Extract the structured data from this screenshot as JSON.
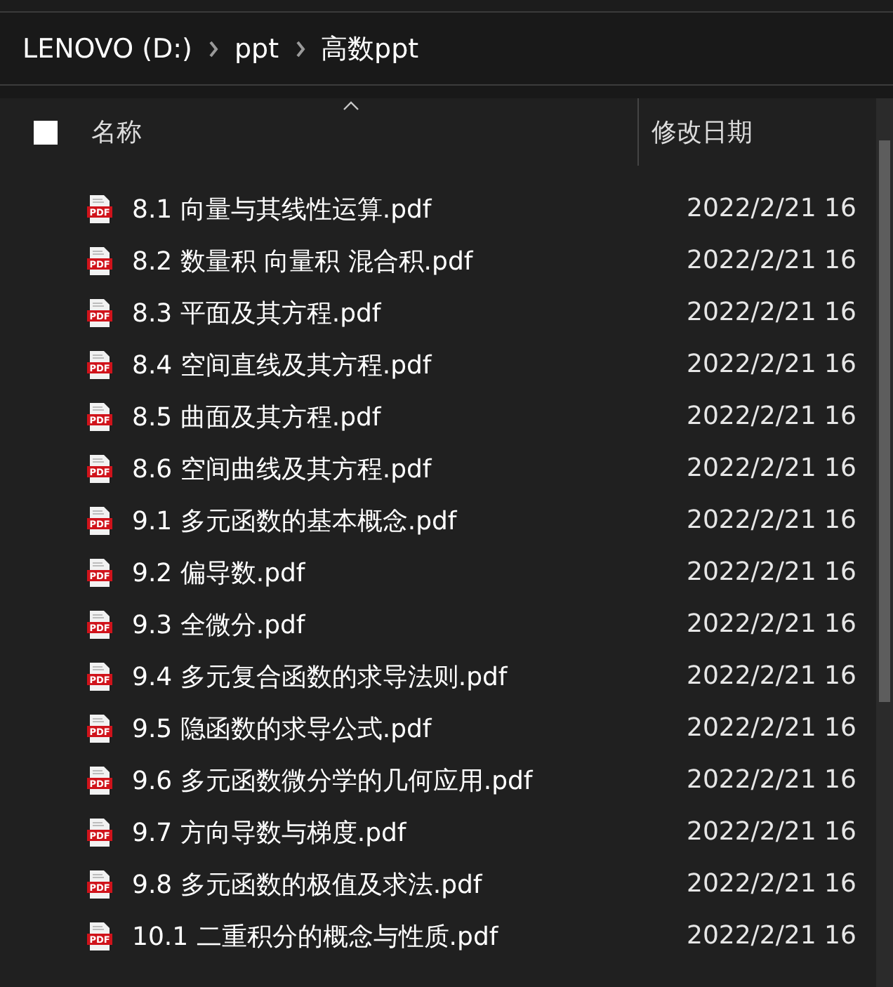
{
  "breadcrumb": [
    {
      "label": "LENOVO (D:)"
    },
    {
      "label": "ppt"
    },
    {
      "label": "高数ppt"
    }
  ],
  "header": {
    "select_all": {
      "checked": false
    },
    "columns": [
      {
        "label": "名称",
        "sorted": true
      },
      {
        "label": "修改日期",
        "sorted": false
      }
    ]
  },
  "files": [
    {
      "badge": "PDF",
      "name": "8.1 向量与其线性运算.pdf",
      "modified": "2022/2/21 16"
    },
    {
      "badge": "PDF",
      "name": "8.2 数量积 向量积 混合积.pdf",
      "modified": "2022/2/21 16"
    },
    {
      "badge": "PDF",
      "name": "8.3 平面及其方程.pdf",
      "modified": "2022/2/21 16"
    },
    {
      "badge": "PDF",
      "name": "8.4 空间直线及其方程.pdf",
      "modified": "2022/2/21 16"
    },
    {
      "badge": "PDF",
      "name": "8.5 曲面及其方程.pdf",
      "modified": "2022/2/21 16"
    },
    {
      "badge": "PDF",
      "name": "8.6 空间曲线及其方程.pdf",
      "modified": "2022/2/21 16"
    },
    {
      "badge": "PDF",
      "name": "9.1 多元函数的基本概念.pdf",
      "modified": "2022/2/21 16"
    },
    {
      "badge": "PDF",
      "name": "9.2 偏导数.pdf",
      "modified": "2022/2/21 16"
    },
    {
      "badge": "PDF",
      "name": "9.3 全微分.pdf",
      "modified": "2022/2/21 16"
    },
    {
      "badge": "PDF",
      "name": "9.4 多元复合函数的求导法则.pdf",
      "modified": "2022/2/21 16"
    },
    {
      "badge": "PDF",
      "name": "9.5 隐函数的求导公式.pdf",
      "modified": "2022/2/21 16"
    },
    {
      "badge": "PDF",
      "name": "9.6 多元函数微分学的几何应用.pdf",
      "modified": "2022/2/21 16"
    },
    {
      "badge": "PDF",
      "name": "9.7 方向导数与梯度.pdf",
      "modified": "2022/2/21 16"
    },
    {
      "badge": "PDF",
      "name": "9.8 多元函数的极值及求法.pdf",
      "modified": "2022/2/21 16"
    },
    {
      "badge": "PDF",
      "name": "10.1 二重积分的概念与性质.pdf",
      "modified": "2022/2/21 16"
    }
  ]
}
